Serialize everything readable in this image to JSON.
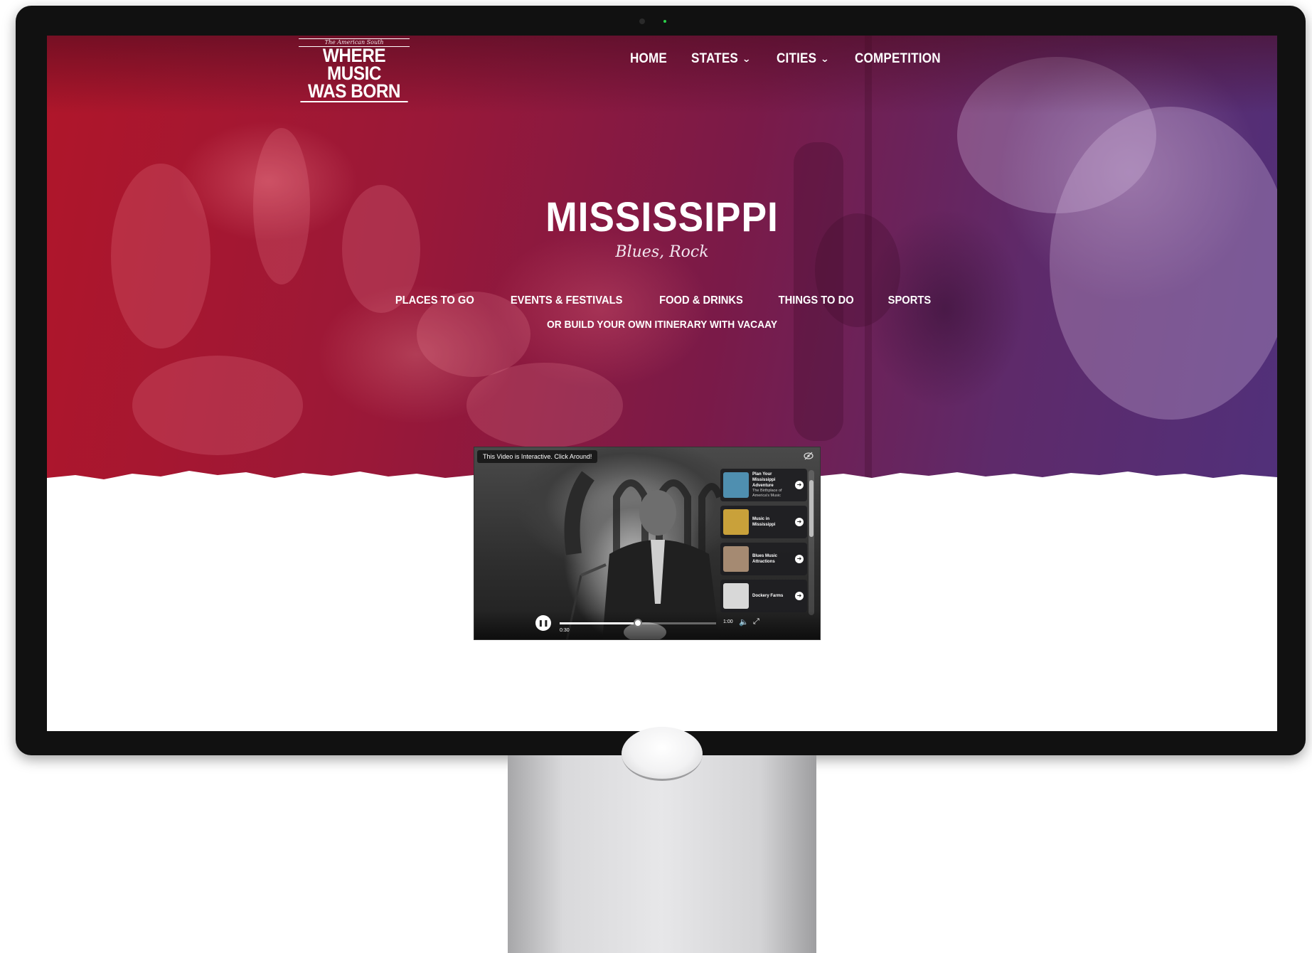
{
  "site": {
    "logo": {
      "tagline": "The American South",
      "line1": "WHERE MUSIC",
      "line2": "WAS BORN"
    },
    "nav": [
      {
        "label": "HOME",
        "has_dropdown": false
      },
      {
        "label": "STATES",
        "has_dropdown": true
      },
      {
        "label": "CITIES",
        "has_dropdown": true
      },
      {
        "label": "COMPETITION",
        "has_dropdown": false
      }
    ]
  },
  "hero": {
    "title": "MISSISSIPPI",
    "subtitle": "Blues, Rock",
    "categories": [
      "PLACES TO GO",
      "EVENTS & FESTIVALS",
      "FOOD & DRINKS",
      "THINGS TO DO",
      "SPORTS"
    ],
    "itinerary_link": "OR BUILD YOUR OWN ITINERARY WITH VACAAY"
  },
  "video": {
    "notice": "This Video is Interactive. Click Around!",
    "hide_icon": "eye-off-icon",
    "playlist": [
      {
        "title": "Plan Your Mississippi Adventure",
        "subtitle": "The Birthplace of America's Music",
        "thumb_color": "#4f8fb0"
      },
      {
        "title": "Music in Mississippi",
        "subtitle": "",
        "thumb_color": "#c9a13a"
      },
      {
        "title": "Blues Music Attractions",
        "subtitle": "",
        "thumb_color": "#a58a72"
      },
      {
        "title": "Dockery Farms",
        "subtitle": "",
        "thumb_color": "#d8d8d8"
      }
    ],
    "current_time": "0:30",
    "total_time": "1:00",
    "progress": 0.5,
    "playing": true
  },
  "chevron": "⌄",
  "colors": {
    "hero_red": "#b0162a",
    "hero_purple": "#51307a",
    "monitor_bezel": "#111111"
  }
}
